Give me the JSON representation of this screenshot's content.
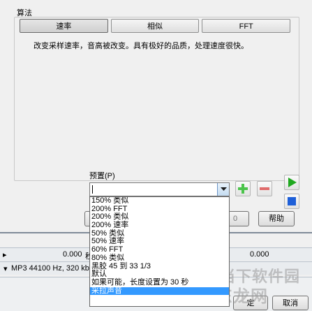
{
  "algorithm": {
    "label": "算法",
    "tabs": [
      "速率",
      "相似",
      "FFT"
    ],
    "description": "改变采样速率，音高被改变。具有极好的品质，处理速度很快。"
  },
  "preset": {
    "label": "预置(P)",
    "value": "",
    "options": [
      "150% 类似",
      "200% FFT",
      "200% 类似",
      "200% 速率",
      "50% 类似",
      "50% 速率",
      "60% FFT",
      "80% 类似",
      "黑胶 45 到 33 1/3",
      "默认",
      "如果可能，长度设置为 30 秒",
      "采拉声音"
    ],
    "selected_index": 11
  },
  "buttons": {
    "help": "帮助",
    "middle_partial": "0",
    "ok_partial": "定",
    "cancel": "取消"
  },
  "bottom_panel": {
    "row1_left": "0.000",
    "row1_left_suffix": "秒",
    "row1_right": "0.000",
    "row2_left": "MP3 44100 Hz, 320 kb"
  },
  "icons": {
    "add": "plus-icon",
    "remove": "minus-icon",
    "play": "play-icon",
    "stop": "stop-icon",
    "dropdown": "chevron-down-icon"
  },
  "watermark": {
    "line1": "当下软件园",
    "line2": "东龙网"
  },
  "colors": {
    "selection": "#3399ff",
    "play_green": "#1fa81f",
    "stop_blue": "#1e5fd8",
    "add_green": "#4cc44c",
    "remove_red": "#e06b6b"
  }
}
